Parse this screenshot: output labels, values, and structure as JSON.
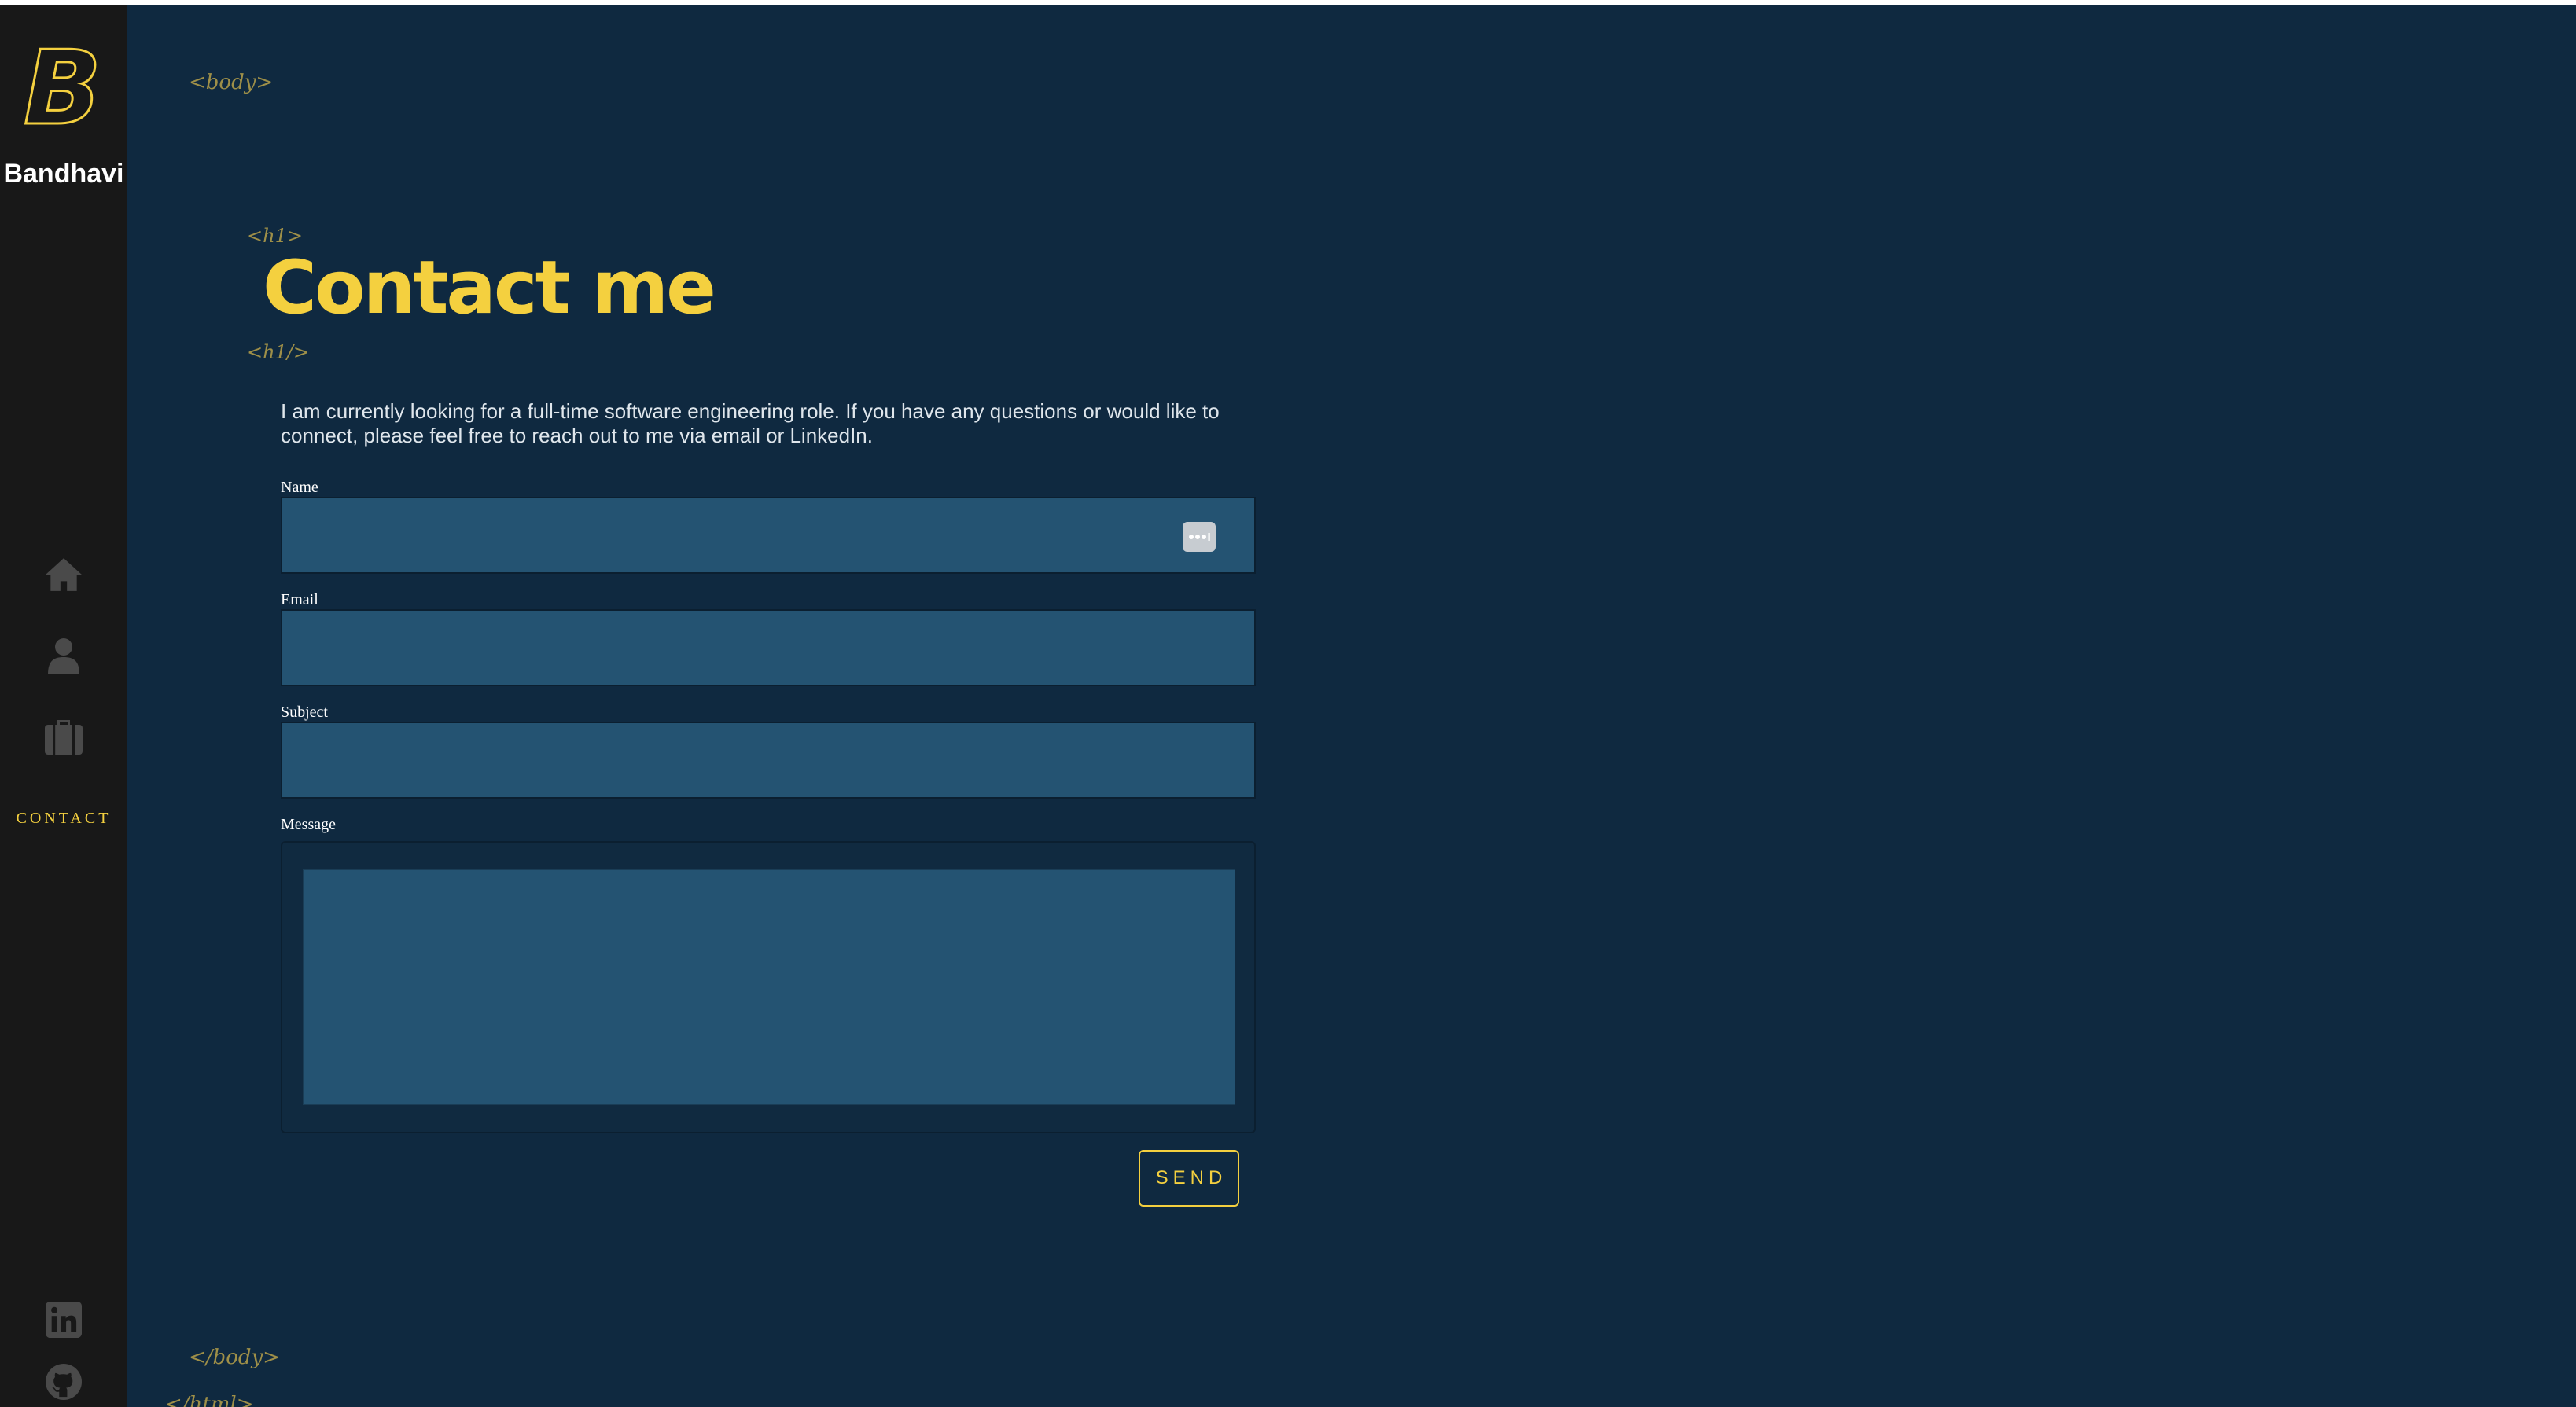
{
  "sidebar": {
    "logo_letter": "B",
    "logo_name": "Bandhavi",
    "nav": {
      "home_icon": "home-icon",
      "about_icon": "person-icon",
      "work_icon": "briefcase-icon",
      "contact_label": "CONTACT"
    },
    "social": {
      "linkedin_icon": "linkedin-icon",
      "github_icon": "github-icon"
    },
    "icon_color": "#4a4a4a",
    "background": "#181818"
  },
  "decor": {
    "body_open": "<body>",
    "body_close": "</body>",
    "html_close": "</html>",
    "h1_open": "<h1>",
    "h1_close": "<h1/>"
  },
  "main": {
    "heading": "Contact me",
    "intro": "I am currently looking for a full-time software engineering role. If you have any questions or would like to connect, please feel free to reach out to me via email or LinkedIn.",
    "form": {
      "name_label": "Name",
      "name_value": "",
      "email_label": "Email",
      "email_value": "",
      "subject_label": "Subject",
      "subject_value": "",
      "message_label": "Message",
      "message_value": "",
      "send_label": "SEND",
      "autofill_icon": "password-manager-icon"
    }
  },
  "colors": {
    "background": "#0f2940",
    "accent": "#f4d03f",
    "field": "#245372"
  }
}
